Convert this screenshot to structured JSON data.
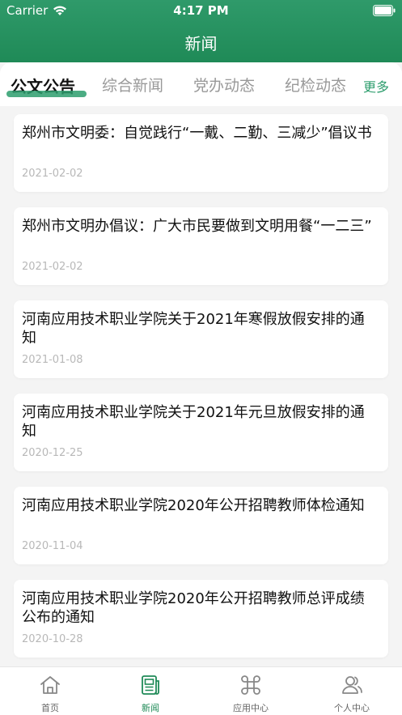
{
  "status_bar": {
    "carrier": "Carrier",
    "time": "4:17 PM"
  },
  "header": {
    "title": "新闻"
  },
  "tabs": [
    {
      "label": "公文公告",
      "active": true
    },
    {
      "label": "综合新闻",
      "active": false
    },
    {
      "label": "党办动态",
      "active": false
    },
    {
      "label": "纪检动态",
      "active": false
    }
  ],
  "more_label": "更多",
  "news": [
    {
      "title": "郑州市文明委：自觉践行“一戴、二勤、三减少”倡议书",
      "date": "2021-02-02"
    },
    {
      "title": "郑州市文明办倡议：广大市民要做到文明用餐“一二三”",
      "date": "2021-02-02"
    },
    {
      "title": "河南应用技术职业学院关于2021年寒假放假安排的通知",
      "date": "2021-01-08"
    },
    {
      "title": "河南应用技术职业学院关于2021年元旦放假安排的通知",
      "date": "2020-12-25"
    },
    {
      "title": "河南应用技术职业学院2020年公开招聘教师体检通知",
      "date": "2020-11-04"
    },
    {
      "title": "河南应用技术职业学院2020年公开招聘教师总评成绩公布的通知",
      "date": "2020-10-28"
    }
  ],
  "tabbar": [
    {
      "label": "首页",
      "icon": "home-icon",
      "active": false
    },
    {
      "label": "新闻",
      "icon": "news-icon",
      "active": true
    },
    {
      "label": "应用中心",
      "icon": "command-icon",
      "active": false
    },
    {
      "label": "个人中心",
      "icon": "person-icon",
      "active": false
    }
  ],
  "colors": {
    "brand": "#1f8a57",
    "accent": "#2d9d6d"
  }
}
